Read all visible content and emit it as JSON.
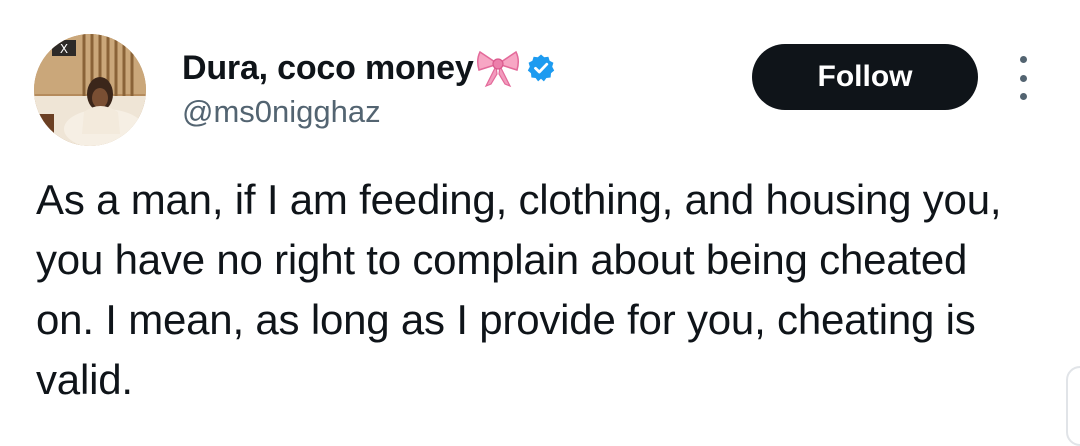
{
  "tweet": {
    "author": {
      "display_name": "Dura, coco money",
      "emoji_icon": "pink-ribbon-bow-icon",
      "verified_icon": "verified-badge-icon",
      "handle": "@ms0nigghaz"
    },
    "follow_label": "Follow",
    "more_icon": "more-options-icon",
    "text": "As a man, if I am feeding, clothing, and housing you, you have no right to complain about being cheated on. I mean, as long as I provide for you, cheating is valid."
  },
  "colors": {
    "text_primary": "#0f1419",
    "text_secondary": "#536471",
    "verified_blue": "#1d9bf0",
    "button_bg": "#0f1419",
    "bow_pink": "#f7a6c4"
  }
}
